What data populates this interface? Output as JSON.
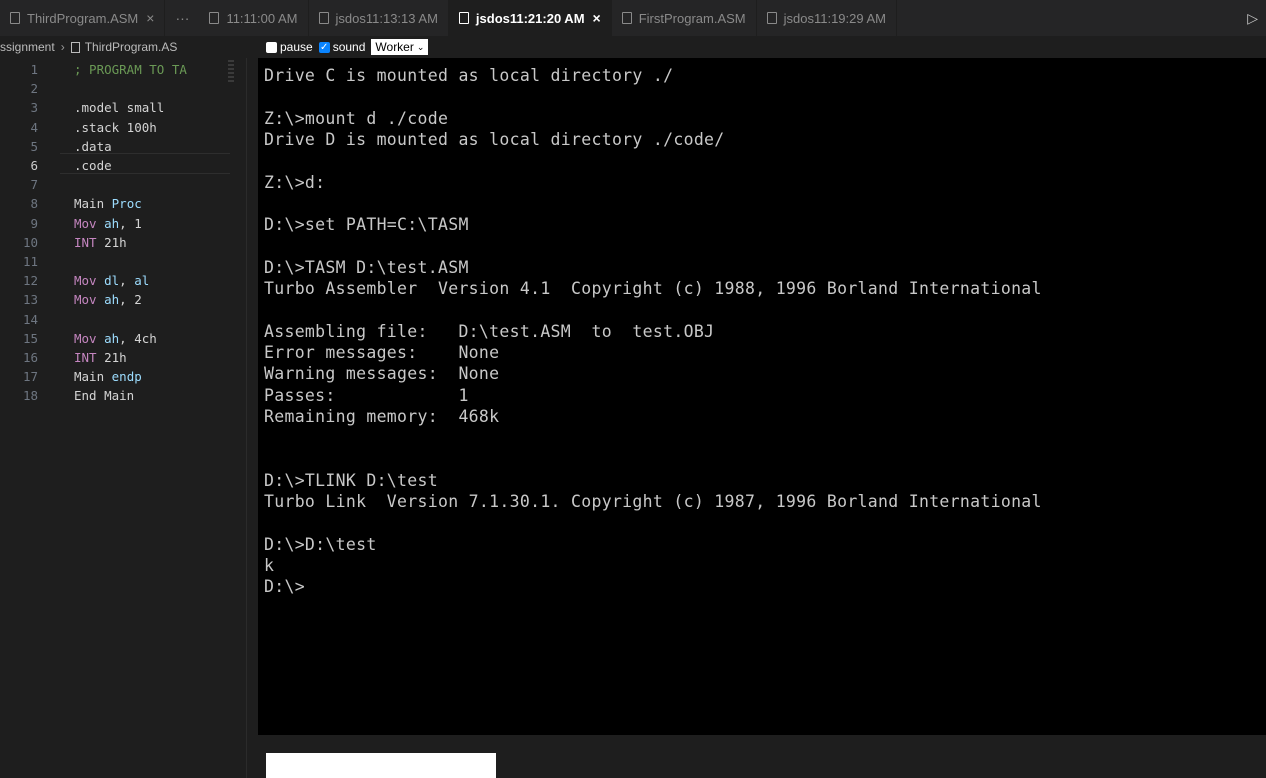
{
  "colors": {
    "background": "#1e1e1e",
    "terminal_bg": "#000000",
    "terminal_fg": "#c8c8c8",
    "keyword": "#c586c0",
    "register": "#9cdcfe",
    "comment": "#6a9955",
    "text": "#d4d4d4",
    "checkbox_accent": "#0a84ff"
  },
  "tabs": [
    {
      "label": "ThirdProgram.ASM",
      "close": "×",
      "active": false
    },
    {
      "label": "11:11:00 AM",
      "close": "",
      "active": false
    },
    {
      "label": "jsdos11:13:13 AM",
      "close": "",
      "active": false
    },
    {
      "label": "jsdos11:21:20 AM",
      "close": "×",
      "active": true
    },
    {
      "label": "FirstProgram.ASM",
      "close": "",
      "active": false
    },
    {
      "label": "jsdos11:19:29 AM",
      "close": "",
      "active": false
    }
  ],
  "tab_more": "···",
  "tab_run": "▷",
  "breadcrumb": [
    "ssignment",
    "ThirdProgram.AS"
  ],
  "controls": {
    "pause_label": "pause",
    "pause_checked": false,
    "sound_label": "sound",
    "sound_checked": true,
    "worker_value": "Worker",
    "worker_chevron": "⌄"
  },
  "editor": {
    "current_line": 6,
    "lines": [
      {
        "num": "1",
        "tokens": [
          {
            "t": "; PROGRAM TO TA",
            "c": "comment"
          }
        ]
      },
      {
        "num": "2",
        "tokens": []
      },
      {
        "num": "3",
        "tokens": [
          {
            "t": ".model small",
            "c": "text"
          }
        ]
      },
      {
        "num": "4",
        "tokens": [
          {
            "t": ".stack 100h",
            "c": "text"
          }
        ]
      },
      {
        "num": "5",
        "tokens": [
          {
            "t": ".data",
            "c": "text"
          }
        ]
      },
      {
        "num": "6",
        "tokens": [
          {
            "t": ".code",
            "c": "text"
          }
        ]
      },
      {
        "num": "7",
        "tokens": []
      },
      {
        "num": "8",
        "tokens": [
          {
            "t": "Main ",
            "c": "text"
          },
          {
            "t": "Proc",
            "c": "register"
          }
        ]
      },
      {
        "num": "9",
        "tokens": [
          {
            "t": "Mov ",
            "c": "keyword"
          },
          {
            "t": "ah",
            "c": "register"
          },
          {
            "t": ", 1",
            "c": "text"
          }
        ]
      },
      {
        "num": "10",
        "tokens": [
          {
            "t": "INT ",
            "c": "keyword"
          },
          {
            "t": "21h",
            "c": "text"
          }
        ]
      },
      {
        "num": "11",
        "tokens": []
      },
      {
        "num": "12",
        "tokens": [
          {
            "t": "Mov ",
            "c": "keyword"
          },
          {
            "t": "dl",
            "c": "register"
          },
          {
            "t": ", ",
            "c": "text"
          },
          {
            "t": "al",
            "c": "register"
          }
        ]
      },
      {
        "num": "13",
        "tokens": [
          {
            "t": "Mov ",
            "c": "keyword"
          },
          {
            "t": "ah",
            "c": "register"
          },
          {
            "t": ", 2",
            "c": "text"
          }
        ]
      },
      {
        "num": "14",
        "tokens": []
      },
      {
        "num": "15",
        "tokens": [
          {
            "t": "Mov ",
            "c": "keyword"
          },
          {
            "t": "ah",
            "c": "register"
          },
          {
            "t": ", 4ch",
            "c": "text"
          }
        ]
      },
      {
        "num": "16",
        "tokens": [
          {
            "t": "INT ",
            "c": "keyword"
          },
          {
            "t": "21h",
            "c": "text"
          }
        ]
      },
      {
        "num": "17",
        "tokens": [
          {
            "t": "Main ",
            "c": "text"
          },
          {
            "t": "endp",
            "c": "register"
          }
        ]
      },
      {
        "num": "18",
        "tokens": [
          {
            "t": "End Main",
            "c": "text"
          }
        ]
      }
    ]
  },
  "terminal": {
    "lines": [
      "Drive C is mounted as local directory ./",
      "",
      "Z:\\>mount d ./code",
      "Drive D is mounted as local directory ./code/",
      "",
      "Z:\\>d:",
      "",
      "D:\\>set PATH=C:\\TASM",
      "",
      "D:\\>TASM D:\\test.ASM",
      "Turbo Assembler  Version 4.1  Copyright (c) 1988, 1996 Borland International",
      "",
      "Assembling file:   D:\\test.ASM  to  test.OBJ",
      "Error messages:    None",
      "Warning messages:  None",
      "Passes:            1",
      "Remaining memory:  468k",
      "",
      "",
      "D:\\>TLINK D:\\test",
      "Turbo Link  Version 7.1.30.1. Copyright (c) 1987, 1996 Borland International",
      "",
      "D:\\>D:\\test",
      "k",
      "D:\\>"
    ]
  }
}
